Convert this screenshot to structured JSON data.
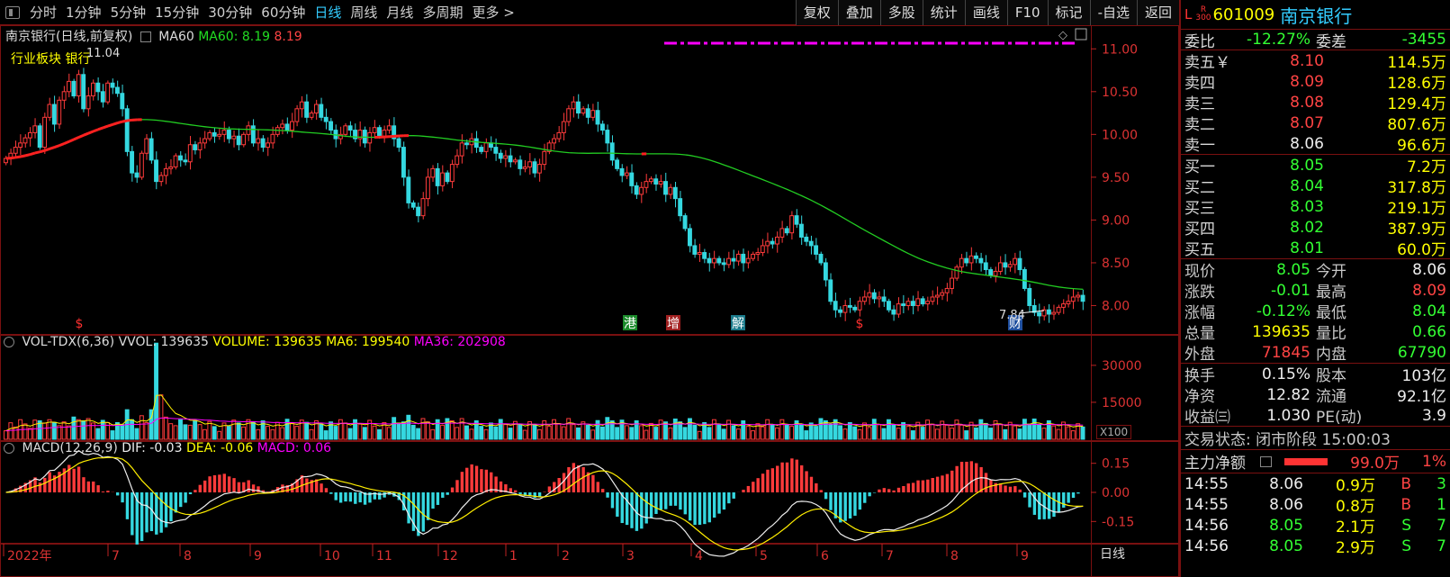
{
  "toolbar": {
    "tabs": [
      "分时",
      "1分钟",
      "5分钟",
      "15分钟",
      "30分钟",
      "60分钟",
      "日线",
      "周线",
      "月线",
      "多周期",
      "更多 >"
    ],
    "active_tab": 6,
    "right_tools": [
      "复权",
      "叠加",
      "多股",
      "统计",
      "画线",
      "F10",
      "标记",
      "-自选",
      "返回"
    ]
  },
  "chart_header": {
    "title": "南京银行(日线,前复权)",
    "ma_label": "MA60",
    "ma_value": "MA60: 8.19",
    "ma_value2": "8.19",
    "sector": "行业板块 银行",
    "peak_label": "11.04",
    "low_label": "7.84"
  },
  "vol_header": {
    "name": "VOL-TDX(6,36)",
    "vvol": "VVOL: 139635",
    "volume": "VOLUME: 139635",
    "ma6": "MA6: 199540",
    "ma36": "MA36: 202908",
    "unit": "X100"
  },
  "macd_header": {
    "name": "MACD(12,26,9)",
    "dif": "DIF: -0.03",
    "dea": "DEA: -0.06",
    "macd": "MACD: 0.06"
  },
  "price_axis": [
    "11.00",
    "10.50",
    "10.00",
    "9.50",
    "9.00",
    "8.50",
    "8.00"
  ],
  "vol_axis": [
    "30000",
    "15000"
  ],
  "macd_axis": [
    "0.15",
    "0.00",
    "-0.15"
  ],
  "x_axis": [
    "2022年",
    "7",
    "8",
    "9",
    "10",
    "11",
    "12",
    "1",
    "2",
    "3",
    "4",
    "5",
    "6",
    "7",
    "8",
    "9"
  ],
  "period_label": "日线",
  "event_marks": [
    {
      "text": "$",
      "color": "#ff3030",
      "bg": ""
    },
    {
      "text": "港",
      "color": "#ffffff",
      "bg": "#1a8a2a"
    },
    {
      "text": "增",
      "color": "#ffffff",
      "bg": "#a02020"
    },
    {
      "text": "解",
      "color": "#ffffff",
      "bg": "#1a7a8a"
    },
    {
      "text": "$",
      "color": "#ff3030",
      "bg": ""
    },
    {
      "text": "财",
      "color": "#ffffff",
      "bg": "#2050a0"
    }
  ],
  "colors": {
    "up": "#ff3b3b",
    "down": "#35d8e0",
    "ma60": "#22cc22",
    "magenta": "#ff00ff",
    "yellow": "#ffee00",
    "white": "#eeeeee"
  },
  "chart_data": {
    "type": "candlestick",
    "ylim": [
      7.7,
      11.15
    ],
    "closes": [
      9.72,
      9.78,
      9.85,
      9.9,
      9.96,
      10.02,
      10.1,
      9.85,
      10.2,
      10.35,
      10.12,
      10.4,
      10.5,
      10.62,
      10.45,
      10.7,
      10.3,
      10.45,
      10.6,
      10.5,
      10.38,
      10.6,
      10.55,
      10.48,
      10.3,
      9.8,
      9.55,
      9.5,
      9.78,
      9.95,
      9.7,
      9.45,
      9.52,
      9.6,
      9.62,
      9.75,
      9.7,
      9.68,
      9.88,
      9.82,
      9.9,
      9.95,
      10.02,
      9.98,
      10.0,
      10.05,
      9.95,
      9.98,
      9.88,
      10.0,
      10.1,
      9.9,
      9.95,
      9.85,
      9.9,
      10.0,
      10.08,
      10.12,
      10.05,
      10.15,
      10.3,
      10.38,
      10.2,
      10.25,
      10.35,
      10.2,
      10.15,
      10.05,
      9.95,
      10.0,
      10.1,
      10.05,
      9.95,
      10.05,
      9.9,
      10.02,
      10.08,
      9.98,
      10.05,
      10.1,
      9.95,
      9.85,
      9.5,
      9.2,
      9.15,
      9.05,
      9.25,
      9.5,
      9.6,
      9.4,
      9.55,
      9.45,
      9.65,
      9.75,
      9.9,
      9.88,
      9.95,
      9.85,
      9.8,
      9.9,
      9.85,
      9.78,
      9.72,
      9.75,
      9.68,
      9.7,
      9.6,
      9.62,
      9.68,
      9.55,
      9.65,
      9.8,
      9.9,
      9.95,
      10.02,
      10.15,
      10.3,
      10.38,
      10.25,
      10.3,
      10.2,
      10.28,
      10.12,
      10.05,
      9.9,
      9.7,
      9.6,
      9.52,
      9.55,
      9.4,
      9.3,
      9.38,
      9.45,
      9.48,
      9.42,
      9.45,
      9.3,
      9.38,
      9.25,
      9.05,
      8.9,
      8.7,
      8.6,
      8.62,
      8.55,
      8.5,
      8.55,
      8.5,
      8.48,
      8.55,
      8.52,
      8.6,
      8.5,
      8.55,
      8.6,
      8.62,
      8.7,
      8.75,
      8.72,
      8.8,
      8.9,
      8.85,
      9.05,
      8.95,
      8.8,
      8.75,
      8.7,
      8.6,
      8.5,
      8.3,
      8.05,
      7.95,
      7.92,
      8.0,
      7.98,
      7.95,
      8.05,
      8.1,
      8.15,
      8.08,
      8.1,
      8.05,
      7.95,
      7.9,
      8.02,
      8.0,
      8.05,
      8.0,
      8.08,
      8.02,
      8.05,
      8.1,
      8.12,
      8.15,
      8.2,
      8.32,
      8.45,
      8.55,
      8.5,
      8.58,
      8.55,
      8.5,
      8.42,
      8.35,
      8.4,
      8.5,
      8.45,
      8.48,
      8.55,
      8.42,
      8.2,
      8.0,
      7.92,
      7.88,
      7.95,
      7.9,
      7.92,
      7.98,
      8.02,
      8.05,
      8.1,
      8.12,
      8.05
    ],
    "ma60_start": 9.72,
    "ma60_end": 8.19,
    "ticks_price": [
      11.0,
      10.5,
      10.0,
      9.5,
      9.0,
      8.5,
      8.0
    ],
    "vol_ylim": [
      0,
      42000
    ],
    "vol_ticks": [
      30000,
      15000
    ],
    "macd_ylim": [
      -0.26,
      0.26
    ],
    "macd_ticks": [
      0.15,
      0.0,
      -0.15
    ],
    "series": [
      {
        "name": "MA60"
      },
      {
        "name": "VOLUME"
      },
      {
        "name": "DIF"
      },
      {
        "name": "DEA"
      },
      {
        "name": "MACD"
      }
    ]
  },
  "quote": {
    "exchange": "L",
    "badge_top": "R",
    "badge_bottom": "300",
    "code": "601009",
    "name": "南京银行",
    "weibi_label": "委比",
    "weibi": "-12.27%",
    "weicha_label": "委差",
    "weicha": "-3455",
    "sells": [
      {
        "label": "卖五￥",
        "price": "8.10",
        "vol": "114.5万",
        "color": "red"
      },
      {
        "label": "卖四",
        "price": "8.09",
        "vol": "128.6万",
        "color": "red"
      },
      {
        "label": "卖三",
        "price": "8.08",
        "vol": "129.4万",
        "color": "red"
      },
      {
        "label": "卖二",
        "price": "8.07",
        "vol": "807.6万",
        "color": "red"
      },
      {
        "label": "卖一",
        "price": "8.06",
        "vol": "96.6万",
        "color": "white"
      }
    ],
    "buys": [
      {
        "label": "买一",
        "price": "8.05",
        "vol": "7.2万",
        "color": "green"
      },
      {
        "label": "买二",
        "price": "8.04",
        "vol": "317.8万",
        "color": "green"
      },
      {
        "label": "买三",
        "price": "8.03",
        "vol": "219.1万",
        "color": "green"
      },
      {
        "label": "买四",
        "price": "8.02",
        "vol": "387.9万",
        "color": "green"
      },
      {
        "label": "买五",
        "price": "8.01",
        "vol": "60.0万",
        "color": "green"
      }
    ],
    "stats": [
      {
        "l1": "现价",
        "v1": "8.05",
        "c1": "green",
        "l2": "今开",
        "v2": "8.06",
        "c2": "white"
      },
      {
        "l1": "涨跌",
        "v1": "-0.01",
        "c1": "green",
        "l2": "最高",
        "v2": "8.09",
        "c2": "red"
      },
      {
        "l1": "涨幅",
        "v1": "-0.12%",
        "c1": "green",
        "l2": "最低",
        "v2": "8.04",
        "c2": "green"
      },
      {
        "l1": "总量",
        "v1": "139635",
        "c1": "yellow",
        "l2": "量比",
        "v2": "0.66",
        "c2": "green"
      },
      {
        "l1": "外盘",
        "v1": "71845",
        "c1": "red",
        "l2": "内盘",
        "v2": "67790",
        "c2": "green"
      }
    ],
    "stats2": [
      {
        "l1": "换手",
        "v1": "0.15%",
        "l2": "股本",
        "v2": "103亿"
      },
      {
        "l1": "净资",
        "v1": "12.82",
        "l2": "流通",
        "v2": "92.1亿"
      },
      {
        "l1": "收益㈢",
        "v1": "1.030",
        "l2": "PE(动)",
        "v2": "3.9"
      }
    ],
    "trade_status": "交易状态: 闭市阶段 15:00:03",
    "net_label": "主力净额",
    "net_value": "99.0万",
    "net_pct": "1%",
    "ticks": [
      {
        "t": "14:55",
        "p": "8.06",
        "pc": "white",
        "v": "0.9万",
        "bs": "B",
        "bsc": "red",
        "n": "3"
      },
      {
        "t": "14:55",
        "p": "8.06",
        "pc": "white",
        "v": "0.8万",
        "bs": "B",
        "bsc": "red",
        "n": "1"
      },
      {
        "t": "14:56",
        "p": "8.05",
        "pc": "green",
        "v": "2.1万",
        "bs": "S",
        "bsc": "green",
        "n": "7"
      },
      {
        "t": "14:56",
        "p": "8.05",
        "pc": "green",
        "v": "2.9万",
        "bs": "S",
        "bsc": "green",
        "n": "7"
      }
    ]
  }
}
